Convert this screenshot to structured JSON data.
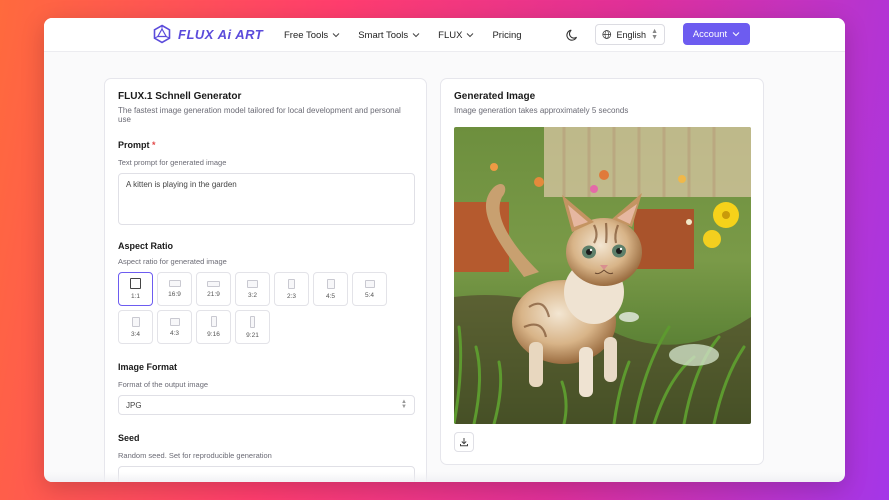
{
  "brand": {
    "logo_text": "FLUX Ai ART",
    "accent_color": "#6d5cf0"
  },
  "nav": {
    "items": [
      {
        "label": "Free Tools",
        "has_dropdown": true
      },
      {
        "label": "Smart Tools",
        "has_dropdown": true
      },
      {
        "label": "FLUX",
        "has_dropdown": true
      },
      {
        "label": "Pricing",
        "has_dropdown": false
      }
    ],
    "theme_icon": "moon-icon",
    "language": "English",
    "account_label": "Account"
  },
  "generator": {
    "title": "FLUX.1 Schnell Generator",
    "subtitle": "The fastest image generation model tailored for local development and personal use",
    "prompt": {
      "label": "Prompt",
      "required_mark": "*",
      "help": "Text prompt for generated image",
      "value": "A kitten is playing in the garden"
    },
    "aspect_ratio": {
      "label": "Aspect Ratio",
      "help": "Aspect ratio for generated image",
      "options": [
        "1:1",
        "16:9",
        "21:9",
        "3:2",
        "2:3",
        "4:5",
        "5:4",
        "3:4",
        "4:3",
        "9:16",
        "9:21"
      ],
      "selected": "1:1"
    },
    "image_format": {
      "label": "Image Format",
      "help": "Format of the output image",
      "value": "JPG"
    },
    "seed": {
      "label": "Seed",
      "help": "Random seed. Set for reproducible generation",
      "value": ""
    }
  },
  "output": {
    "title": "Generated Image",
    "subtitle": "Image generation takes approximately 5 seconds",
    "download_icon": "download-icon"
  }
}
